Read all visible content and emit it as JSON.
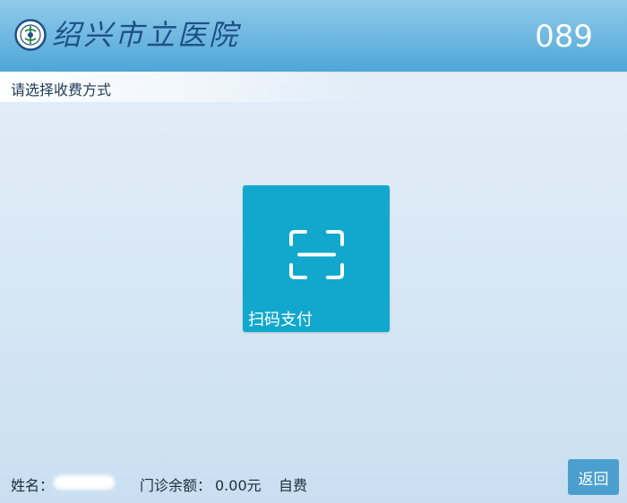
{
  "header": {
    "hospital_name": "绍兴市立医院",
    "terminal_number": "089",
    "logo_icon": "hospital-emblem-icon"
  },
  "instruction": "请选择收费方式",
  "payment_options": [
    {
      "label": "扫码支付",
      "icon": "scan-qr-icon",
      "color": "#12a8cd"
    }
  ],
  "footer": {
    "name_label": "姓名：",
    "balance_label": "门诊余额：",
    "balance_value": "0.00元",
    "payment_type": "自费",
    "back_label": "返回"
  },
  "colors": {
    "header": "#6db7e0",
    "tile": "#12a8cd",
    "back_button": "#4b9fcf"
  }
}
